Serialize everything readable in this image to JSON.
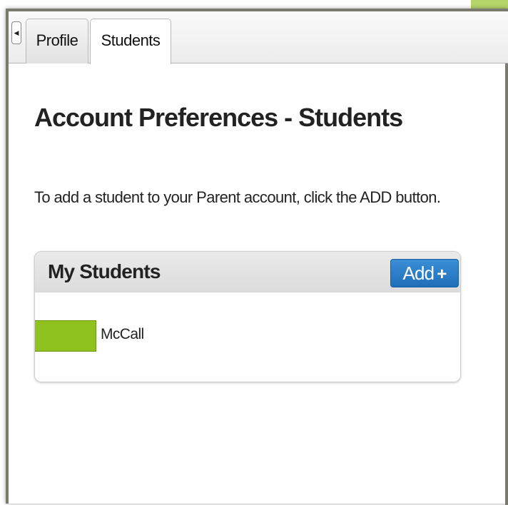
{
  "tabs": [
    {
      "label": "Profile"
    },
    {
      "label": "Students"
    }
  ],
  "page": {
    "heading": "Account Preferences - Students",
    "intro": "To add a student to your Parent account, click the ADD button."
  },
  "students_panel": {
    "title": "My Students",
    "add_label": "Add",
    "add_icon": "+",
    "students": [
      {
        "last_name": "McCall"
      }
    ]
  },
  "colors": {
    "add_button": "#2a7fc9",
    "redaction": "#8fc21f",
    "frame": "#7b7a6f"
  }
}
